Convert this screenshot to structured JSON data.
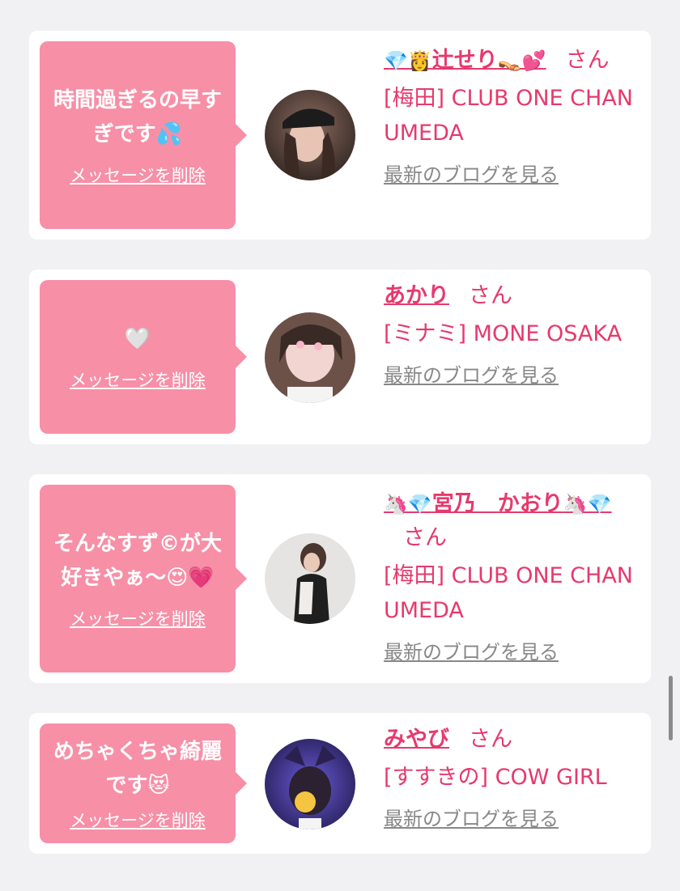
{
  "colors": {
    "bubble": "#f78fa7",
    "accent": "#e7396d",
    "link_gray": "#888888",
    "background": "#f1f1f3"
  },
  "delete_label": "メッセージを削除",
  "honorific": "さん",
  "blog_label": "最新のブログを見る",
  "cards": [
    {
      "message": "時間過ぎるの早すぎです💦",
      "name_prefix": "💎👸",
      "name": "辻せり",
      "name_suffix": "👡💕",
      "shop": "[梅田] CLUB ONE CHAN UMEDA",
      "avatar_icon": "avatar-photo"
    },
    {
      "message": "🤍",
      "name_prefix": "",
      "name": "あかり",
      "name_suffix": "",
      "shop": "[ミナミ] MONE OSAKA",
      "avatar_icon": "avatar-photo"
    },
    {
      "message": "そんなすず©が大好きやぁ〜😍💗",
      "name_prefix": "🦄💎",
      "name": "宮乃　かおり",
      "name_suffix": "🦄💎",
      "shop": "[梅田] CLUB ONE CHAN UMEDA",
      "avatar_icon": "avatar-photo"
    },
    {
      "message": "めちゃくちゃ綺麗です😻",
      "name_prefix": "",
      "name": "みやび",
      "name_suffix": "",
      "shop": "[すすきの] COW GIRL",
      "avatar_icon": "avatar-photo"
    }
  ]
}
